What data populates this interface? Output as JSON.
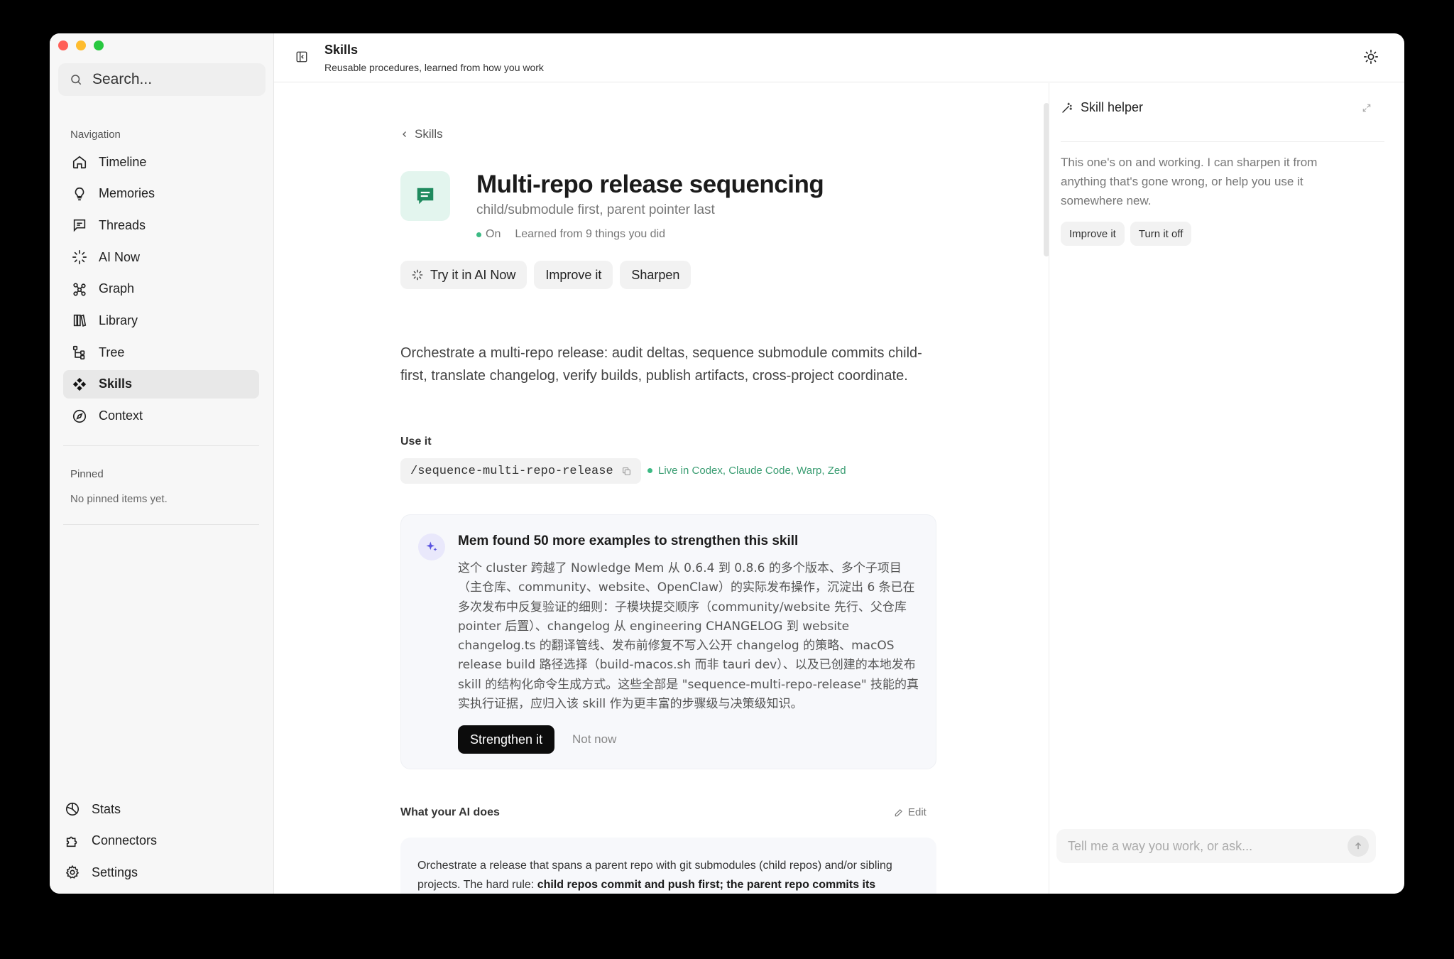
{
  "sidebar": {
    "search_placeholder": "Search...",
    "nav_caption": "Navigation",
    "items": [
      {
        "label": "Timeline",
        "icon": "home-icon"
      },
      {
        "label": "Memories",
        "icon": "bulb-icon"
      },
      {
        "label": "Threads",
        "icon": "chat-icon"
      },
      {
        "label": "AI Now",
        "icon": "sparkle-loader-icon"
      },
      {
        "label": "Graph",
        "icon": "graph-icon"
      },
      {
        "label": "Library",
        "icon": "books-icon"
      },
      {
        "label": "Tree",
        "icon": "tree-icon"
      },
      {
        "label": "Skills",
        "icon": "skills-icon",
        "active": true
      },
      {
        "label": "Context",
        "icon": "compass-icon"
      }
    ],
    "pinned_caption": "Pinned",
    "pinned_empty": "No pinned items yet.",
    "bottom_items": [
      {
        "label": "Stats",
        "icon": "pie-icon"
      },
      {
        "label": "Connectors",
        "icon": "puzzle-icon"
      },
      {
        "label": "Settings",
        "icon": "gear-icon"
      }
    ]
  },
  "header": {
    "title": "Skills",
    "subtitle": "Reusable procedures, learned from how you work"
  },
  "skill": {
    "breadcrumb": "Skills",
    "title": "Multi-repo release sequencing",
    "subtitle": "child/submodule first, parent pointer last",
    "status": "On",
    "learned": "Learned from 9 things you did",
    "actions": {
      "try": "Try it in AI Now",
      "improve": "Improve it",
      "sharpen": "Sharpen"
    },
    "description": "Orchestrate a multi-repo release: audit deltas, sequence submodule commits child-first, translate changelog, verify builds, publish artifacts, cross-project coordinate.",
    "use_label": "Use it",
    "command": "/sequence-multi-repo-release",
    "live": "Live in Codex, Claude Code, Warp, Zed"
  },
  "suggestion": {
    "title": "Mem found 50 more examples to strengthen this skill",
    "body": "这个 cluster 跨越了 Nowledge Mem 从 0.6.4 到 0.8.6 的多个版本、多个子项目（主仓库、community、website、OpenClaw）的实际发布操作，沉淀出 6 条已在多次发布中反复验证的细则：子模块提交顺序（community/website 先行、父仓库 pointer 后置）、changelog 从 engineering CHANGELOG 到 website changelog.ts 的翻译管线、发布前修复不写入公开 changelog 的策略、macOS release build 路径选择（build-macos.sh 而非 tauri dev）、以及已创建的本地发布 skill 的结构化命令生成方式。这些全部是 \"sequence-multi-repo-release\" 技能的真实执行证据，应归入该 skill 作为更丰富的步骤级与决策级知识。",
    "primary": "Strengthen it",
    "secondary": "Not now"
  },
  "rules_section": {
    "label": "What your AI does",
    "edit": "Edit",
    "text_plain": "Orchestrate a release that spans a parent repo with git submodules (child repos) and/or sibling projects. The hard rule: ",
    "text_bold": "child repos commit and push first; the parent repo commits its submodule pointer last."
  },
  "helper": {
    "title": "Skill helper",
    "message": "This one's on and working. I can sharpen it from anything that's gone wrong, or help you use it somewhere new.",
    "actions": {
      "improve": "Improve it",
      "off": "Turn it off"
    },
    "input_placeholder": "Tell me a way you work, or ask..."
  },
  "colors": {
    "accent_green": "#3cba84",
    "skill_icon_bg": "#e3f5ee",
    "primary_button": "#0c0c0c",
    "sparkle": "#5b54e0"
  }
}
